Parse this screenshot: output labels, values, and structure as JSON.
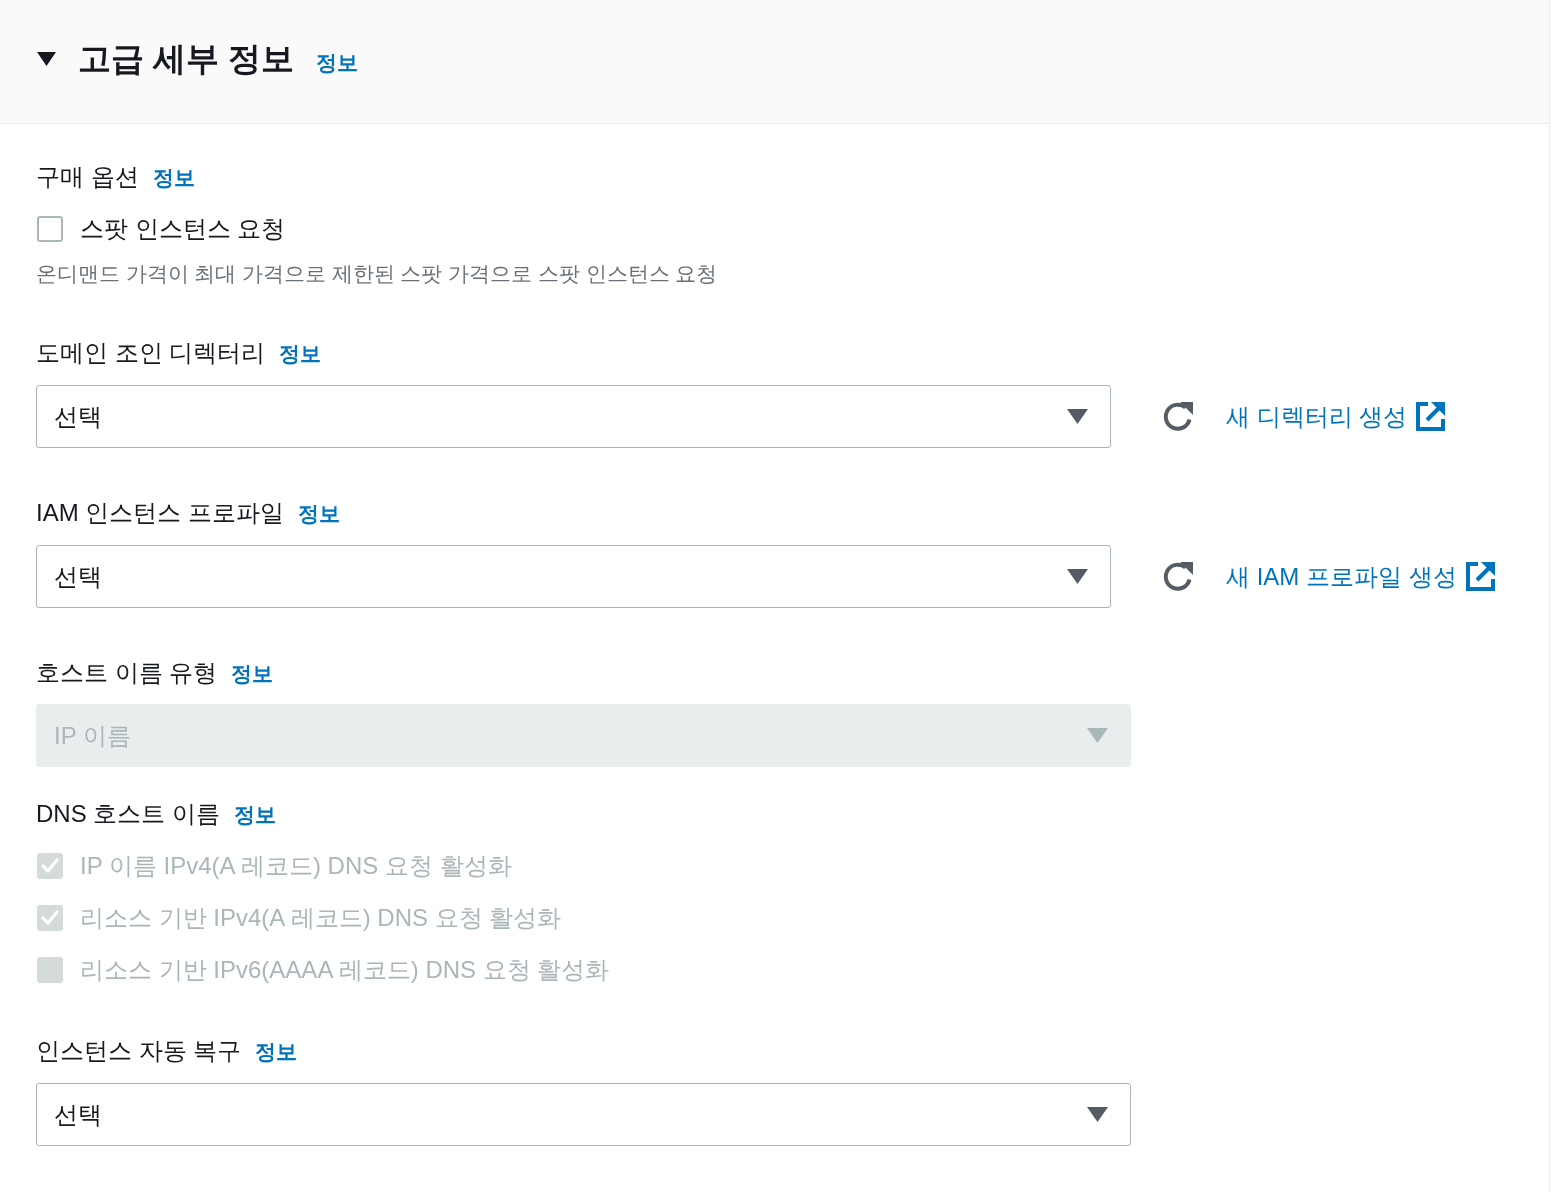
{
  "section": {
    "title": "고급 세부 정보",
    "info_link": "정보",
    "expanded": true
  },
  "fields": [
    {
      "kind": "checkbox_group",
      "label": "구매 옵션",
      "info_link": "정보",
      "options": [
        {
          "label": "스팟 인스턴스 요청",
          "checked": false,
          "disabled": false
        }
      ],
      "description": "온디맨드 가격이 최대 가격으로 제한된 스팟 가격으로 스팟 인스턴스 요청"
    },
    {
      "kind": "select",
      "label": "도메인 조인 디렉터리",
      "info_link": "정보",
      "value": "선택",
      "disabled": false,
      "create_link": "새 디렉터리 생성"
    },
    {
      "kind": "select",
      "label": "IAM 인스턴스 프로파일",
      "info_link": "정보",
      "value": "선택",
      "disabled": false,
      "create_link": "새 IAM 프로파일 생성"
    },
    {
      "kind": "select",
      "label": "호스트 이름 유형",
      "info_link": "정보",
      "value": "IP 이름",
      "disabled": true
    },
    {
      "kind": "checkbox_group",
      "label": "DNS 호스트 이름",
      "info_link": "정보",
      "options": [
        {
          "label": "IP 이름 IPv4(A 레코드) DNS 요청 활성화",
          "checked": true,
          "disabled": true
        },
        {
          "label": "리소스 기반 IPv4(A 레코드) DNS 요청 활성화",
          "checked": true,
          "disabled": true
        },
        {
          "label": "리소스 기반 IPv6(AAAA 레코드) DNS 요청 활성화",
          "checked": false,
          "disabled": true
        }
      ]
    },
    {
      "kind": "select",
      "label": "인스턴스 자동 복구",
      "info_link": "정보",
      "value": "선택",
      "disabled": false
    }
  ]
}
